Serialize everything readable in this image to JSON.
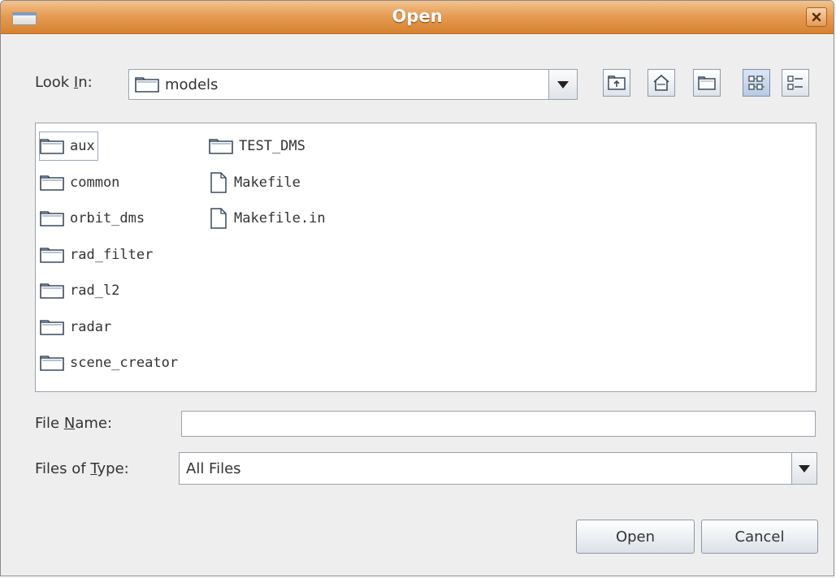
{
  "window": {
    "title": "Open"
  },
  "look_in": {
    "label_prefix": "Look ",
    "label_mnemonic": "I",
    "label_suffix": "n:",
    "value": "models"
  },
  "toolbar": {
    "up_icon": "up-one-level-icon",
    "home_icon": "home-icon",
    "new_folder_icon": "new-folder-icon",
    "list_view_icon": "list-view-icon",
    "details_view_icon": "details-view-icon",
    "active_view": "list"
  },
  "files": {
    "column1": [
      {
        "name": "aux",
        "type": "folder"
      },
      {
        "name": "common",
        "type": "folder"
      },
      {
        "name": "orbit_dms",
        "type": "folder"
      },
      {
        "name": "rad_filter",
        "type": "folder"
      },
      {
        "name": "rad_l2",
        "type": "folder"
      },
      {
        "name": "radar",
        "type": "folder"
      },
      {
        "name": "scene_creator",
        "type": "folder"
      }
    ],
    "column2": [
      {
        "name": "TEST_DMS",
        "type": "folder"
      },
      {
        "name": "Makefile",
        "type": "file"
      },
      {
        "name": "Makefile.in",
        "type": "file"
      }
    ]
  },
  "file_name": {
    "label_prefix": "File ",
    "label_mnemonic": "N",
    "label_suffix": "ame:",
    "value": ""
  },
  "files_of_type": {
    "label_prefix": "Files of ",
    "label_mnemonic": "T",
    "label_suffix": "ype:",
    "value": "All Files"
  },
  "buttons": {
    "open": "Open",
    "cancel": "Cancel"
  },
  "colors": {
    "titlebar": "#e79c54",
    "dialog_bg": "#eeeeee",
    "active_toggle": "#c5d4e9"
  }
}
